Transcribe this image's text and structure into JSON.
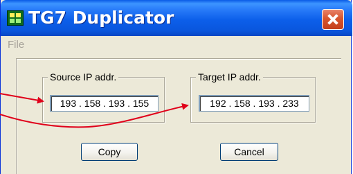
{
  "window": {
    "title": "TG7 Duplicator",
    "icon": "app-icon",
    "close_icon": "close-icon"
  },
  "menu": {
    "items": [
      "File"
    ]
  },
  "source": {
    "label": "Source IP addr.",
    "value": "193 . 158 . 193 . 155"
  },
  "target": {
    "label": "Target IP addr.",
    "value": "192 . 158 . 193 . 233"
  },
  "buttons": {
    "copy": "Copy",
    "cancel": "Cancel"
  },
  "colors": {
    "titlebar": "#0a5be6",
    "face": "#ece9d8",
    "annotation_arrow": "#e0001a"
  }
}
